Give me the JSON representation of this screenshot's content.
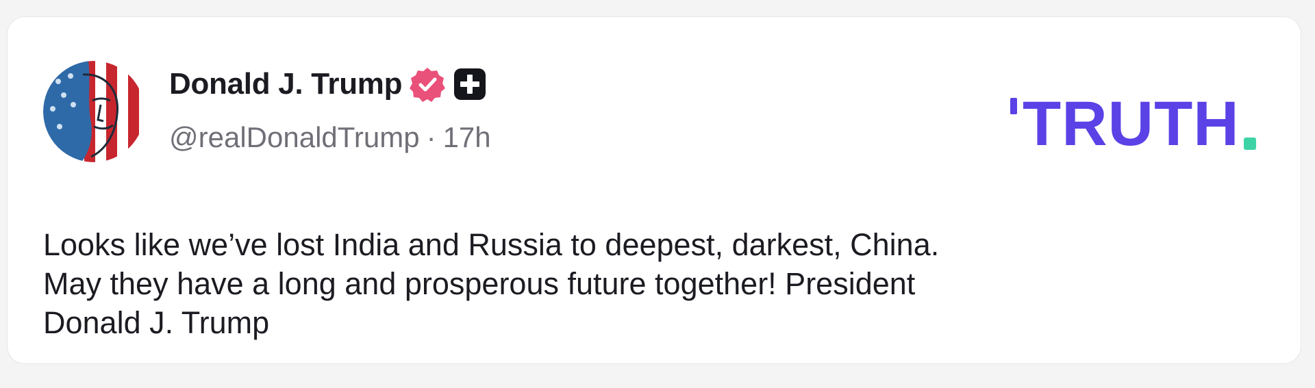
{
  "post": {
    "author_name": "Donald J. Trump",
    "handle": "@realDonaldTrump",
    "separator": "·",
    "time_ago": "17h",
    "text_lines": [
      "Looks like we’ve lost India and Russia to deepest, darkest, China.",
      "May they have a long and prosperous future together! President",
      "Donald J. Trump"
    ]
  },
  "brand": {
    "logo_text": "TRUTH",
    "logo_color": "#5a42e6",
    "logo_period_color": "#3ed3a6"
  },
  "badges": {
    "verified_icon": "verified-badge-icon",
    "verified_color": "#e9507a",
    "plus_icon": "plus-badge-icon"
  },
  "colors": {
    "background": "#f4f4f5",
    "card": "#ffffff",
    "text": "#1b1b22",
    "muted": "#6f6f78"
  }
}
